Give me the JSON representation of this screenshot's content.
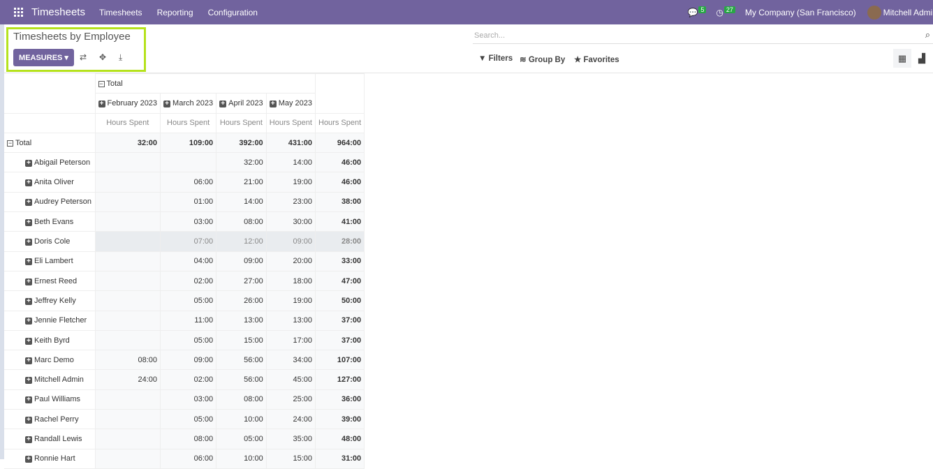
{
  "nav": {
    "app": "Timesheets",
    "menus": [
      "Timesheets",
      "Reporting",
      "Configuration"
    ],
    "messages": "5",
    "activities": "27",
    "company": "My Company (San Francisco)",
    "user": "Mitchell Admin"
  },
  "control": {
    "title": "Timesheets by Employee",
    "measures": "MEASURES",
    "search_placeholder": "Search...",
    "filters": "Filters",
    "group_by": "Group By",
    "favorites": "Favorites"
  },
  "pivot": {
    "total": "Total",
    "columns": [
      "February 2023",
      "March 2023",
      "April 2023",
      "May 2023"
    ],
    "measure": "Hours Spent",
    "total_row": [
      "32:00",
      "109:00",
      "392:00",
      "431:00",
      "964:00"
    ],
    "rows": [
      {
        "name": "Abigail Peterson",
        "v": [
          "",
          "",
          "32:00",
          "14:00",
          "46:00"
        ]
      },
      {
        "name": "Anita Oliver",
        "v": [
          "",
          "06:00",
          "21:00",
          "19:00",
          "46:00"
        ]
      },
      {
        "name": "Audrey Peterson",
        "v": [
          "",
          "01:00",
          "14:00",
          "23:00",
          "38:00"
        ]
      },
      {
        "name": "Beth Evans",
        "v": [
          "",
          "03:00",
          "08:00",
          "30:00",
          "41:00"
        ]
      },
      {
        "name": "Doris Cole",
        "v": [
          "",
          "07:00",
          "12:00",
          "09:00",
          "28:00"
        ]
      },
      {
        "name": "Eli Lambert",
        "v": [
          "",
          "04:00",
          "09:00",
          "20:00",
          "33:00"
        ]
      },
      {
        "name": "Ernest Reed",
        "v": [
          "",
          "02:00",
          "27:00",
          "18:00",
          "47:00"
        ]
      },
      {
        "name": "Jeffrey Kelly",
        "v": [
          "",
          "05:00",
          "26:00",
          "19:00",
          "50:00"
        ]
      },
      {
        "name": "Jennie Fletcher",
        "v": [
          "",
          "11:00",
          "13:00",
          "13:00",
          "37:00"
        ]
      },
      {
        "name": "Keith Byrd",
        "v": [
          "",
          "05:00",
          "15:00",
          "17:00",
          "37:00"
        ]
      },
      {
        "name": "Marc Demo",
        "v": [
          "08:00",
          "09:00",
          "56:00",
          "34:00",
          "107:00"
        ]
      },
      {
        "name": "Mitchell Admin",
        "v": [
          "24:00",
          "02:00",
          "56:00",
          "45:00",
          "127:00"
        ]
      },
      {
        "name": "Paul Williams",
        "v": [
          "",
          "03:00",
          "08:00",
          "25:00",
          "36:00"
        ]
      },
      {
        "name": "Rachel Perry",
        "v": [
          "",
          "05:00",
          "10:00",
          "24:00",
          "39:00"
        ]
      },
      {
        "name": "Randall Lewis",
        "v": [
          "",
          "08:00",
          "05:00",
          "35:00",
          "48:00"
        ]
      },
      {
        "name": "Ronnie Hart",
        "v": [
          "",
          "06:00",
          "10:00",
          "15:00",
          "31:00"
        ]
      }
    ]
  }
}
